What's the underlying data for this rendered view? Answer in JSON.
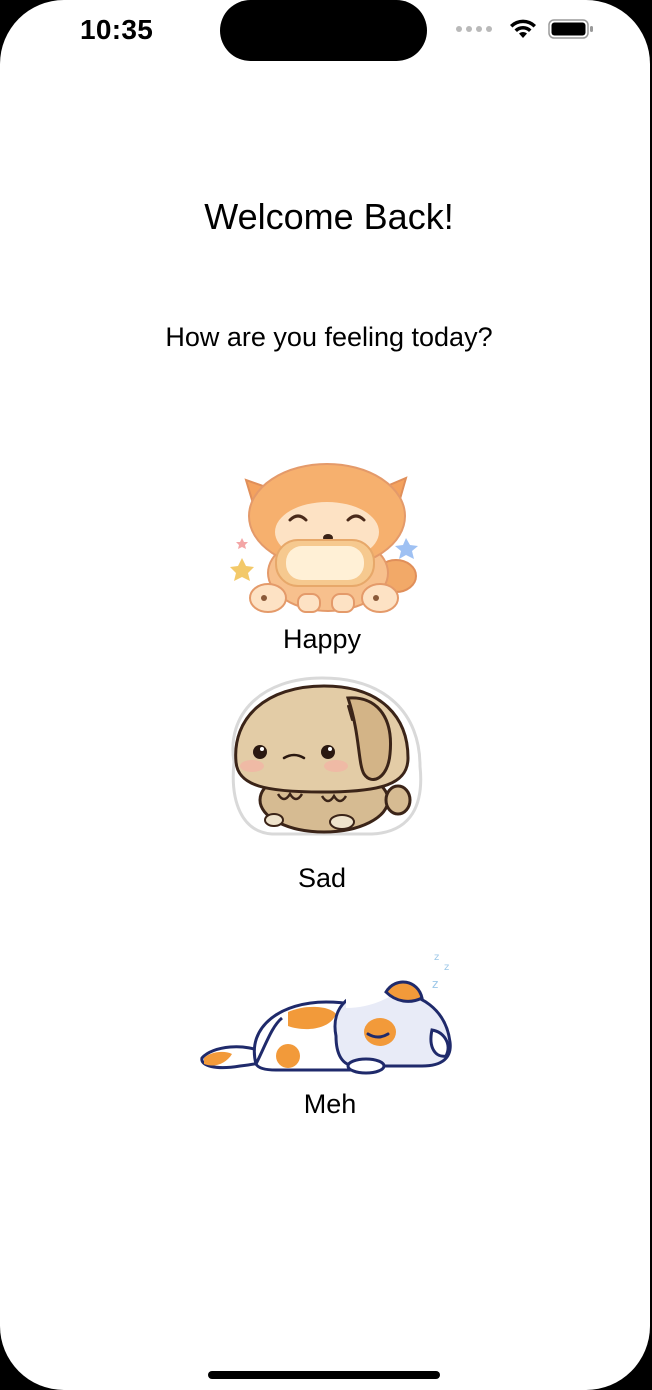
{
  "status_bar": {
    "time": "10:35",
    "icons": [
      "cellular-dots-icon",
      "wifi-icon",
      "battery-icon"
    ]
  },
  "header": {
    "title": "Welcome Back!",
    "subtitle": "How are you feeling today?"
  },
  "moods": [
    {
      "label": "Happy",
      "image": "happy-shiba-dog-sticker",
      "accent": "#f6b26b"
    },
    {
      "label": "Sad",
      "image": "sad-bunny-sticker",
      "accent": "#d8c3a0"
    },
    {
      "label": "Meh",
      "image": "sleeping-cat-sticker",
      "accent": "#f29a3a"
    }
  ],
  "colors": {
    "background": "#ffffff",
    "text": "#000000",
    "frame": "#000000"
  }
}
